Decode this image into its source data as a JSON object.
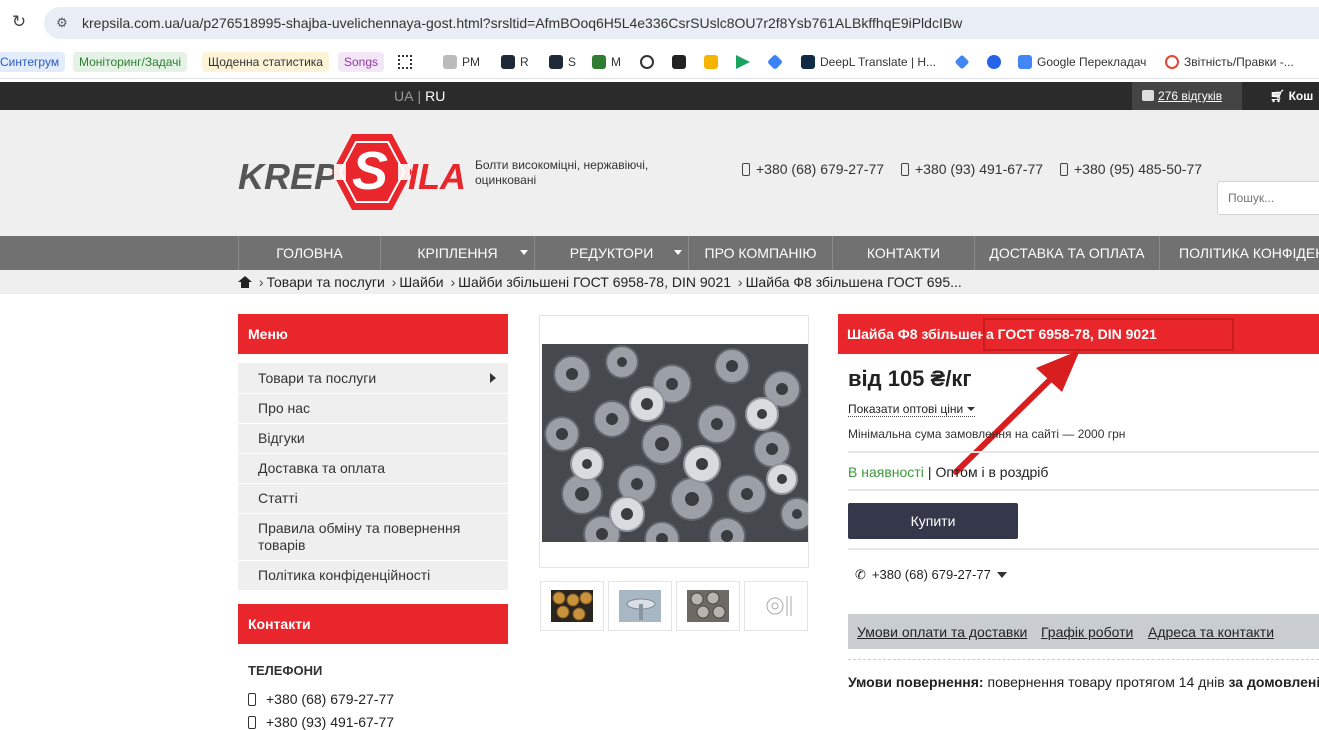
{
  "browser": {
    "url": "krepsila.com.ua/ua/p276518995-shajba-uvelichennaya-gost.html?srsltid=AfmBOoq6H5L4e336CsrSUslc8OU7r2f8Ysb761ALBkffhqE9iPldcIBw",
    "bookmarks": [
      {
        "label": "Синтегрум",
        "bg": "#e3ecfb",
        "color": "#2a5bbf"
      },
      {
        "label": "Моніторинг/Задачі",
        "bg": "#e4f3e6",
        "color": "#2e7d32"
      },
      {
        "label": "Щоденна статистика",
        "bg": "#fdf3d6",
        "color": "#333"
      },
      {
        "label": "Songs",
        "bg": "#f3e6f6",
        "color": "#8e3aa0"
      },
      {
        "label": "",
        "icon": "apps-grid-icon"
      },
      {
        "label": "PM",
        "icon": "pm-icon"
      },
      {
        "label": "R",
        "icon": "r-icon"
      },
      {
        "label": "S",
        "icon": "s-icon"
      },
      {
        "label": "M",
        "icon": "m-icon"
      },
      {
        "label": "",
        "icon": "openai-icon"
      },
      {
        "label": "",
        "icon": "puzzle-icon"
      },
      {
        "label": "",
        "icon": "keep-icon"
      },
      {
        "label": "",
        "icon": "play-icon"
      },
      {
        "label": "",
        "icon": "diamond-icon"
      },
      {
        "label": "DeepL Translate | H...",
        "icon": "deepl-icon"
      },
      {
        "label": "",
        "icon": "gemini-icon"
      },
      {
        "label": "",
        "icon": "copilot-icon"
      },
      {
        "label": "Google Перекладач",
        "icon": "google-translate-icon"
      },
      {
        "label": "Звітність/Правки -...",
        "icon": "google-icon"
      }
    ]
  },
  "topbar": {
    "lang_ua": "UA",
    "lang_sep": "|",
    "lang_ru": "RU",
    "reviews": "276 відгуків",
    "cart": "Кош"
  },
  "header": {
    "logo_left": "KREP",
    "logo_s": "S",
    "logo_right": "ILA",
    "tagline": "Болти високоміцні, нержавіючі, оцинковані",
    "phones": [
      "+380 (68) 679-27-77",
      "+380 (93) 491-67-77",
      "+380 (95) 485-50-77"
    ],
    "search_placeholder": "Пошук..."
  },
  "nav": [
    {
      "label": "ГОЛОВНА",
      "dropdown": false
    },
    {
      "label": "КРІПЛЕННЯ",
      "dropdown": true
    },
    {
      "label": "РЕДУКТОРИ",
      "dropdown": true
    },
    {
      "label": "ПРО КОМПАНІЮ",
      "dropdown": false
    },
    {
      "label": "КОНТАКТИ",
      "dropdown": false
    },
    {
      "label": "ДОСТАВКА ТА ОПЛАТА",
      "dropdown": false
    },
    {
      "label": "ПОЛІТИКА КОНФІДЕНЦІ",
      "dropdown": false
    }
  ],
  "breadcrumb": {
    "sep": "›",
    "items": [
      "Товари та послуги",
      "Шайби",
      "Шайби збільшені ГОСТ 6958-78, DIN 9021",
      "Шайба Ф8 збільшена ГОСТ 695..."
    ]
  },
  "sidebar": {
    "menu_title": "Меню",
    "items": [
      "Товари та послуги",
      "Про нас",
      "Відгуки",
      "Доставка та оплата",
      "Статті",
      "Правила обміну та повернення товарів",
      "Політика конфіденційності"
    ],
    "contacts_title": "Контакти",
    "phones_title": "ТЕЛЕФОНИ",
    "phones": [
      "+380 (68) 679-27-77",
      "+380 (93) 491-67-77"
    ]
  },
  "product": {
    "title": "Шайба Ф8 збільшена ГОСТ 6958-78, DIN 9021",
    "price": "від 105 ₴/кг",
    "wholesale_link": "Показати оптові ціни",
    "min_order": "Мінімальна сума замовлення на сайті — 2000 грн",
    "availability": "В наявності",
    "availability_sep": "|",
    "sale_type": "Оптом і в роздріб",
    "buy_label": "Купити",
    "phone": "+380 (68) 679-27-77",
    "info_tabs": [
      "Умови оплати та доставки",
      "Графік роботи",
      "Адреса та контакти"
    ],
    "returns_label": "Умови повернення:",
    "returns_text": "повернення товару протягом 14 днів",
    "returns_tail": "за домовлені"
  },
  "colors": {
    "brand_red": "#e8262b",
    "nav_gray": "#717171",
    "topbar_dark": "#2b2b2b",
    "buy_button": "#34384a",
    "in_stock_green": "#3a9a3a",
    "annotation_red": "#c81d1d"
  }
}
